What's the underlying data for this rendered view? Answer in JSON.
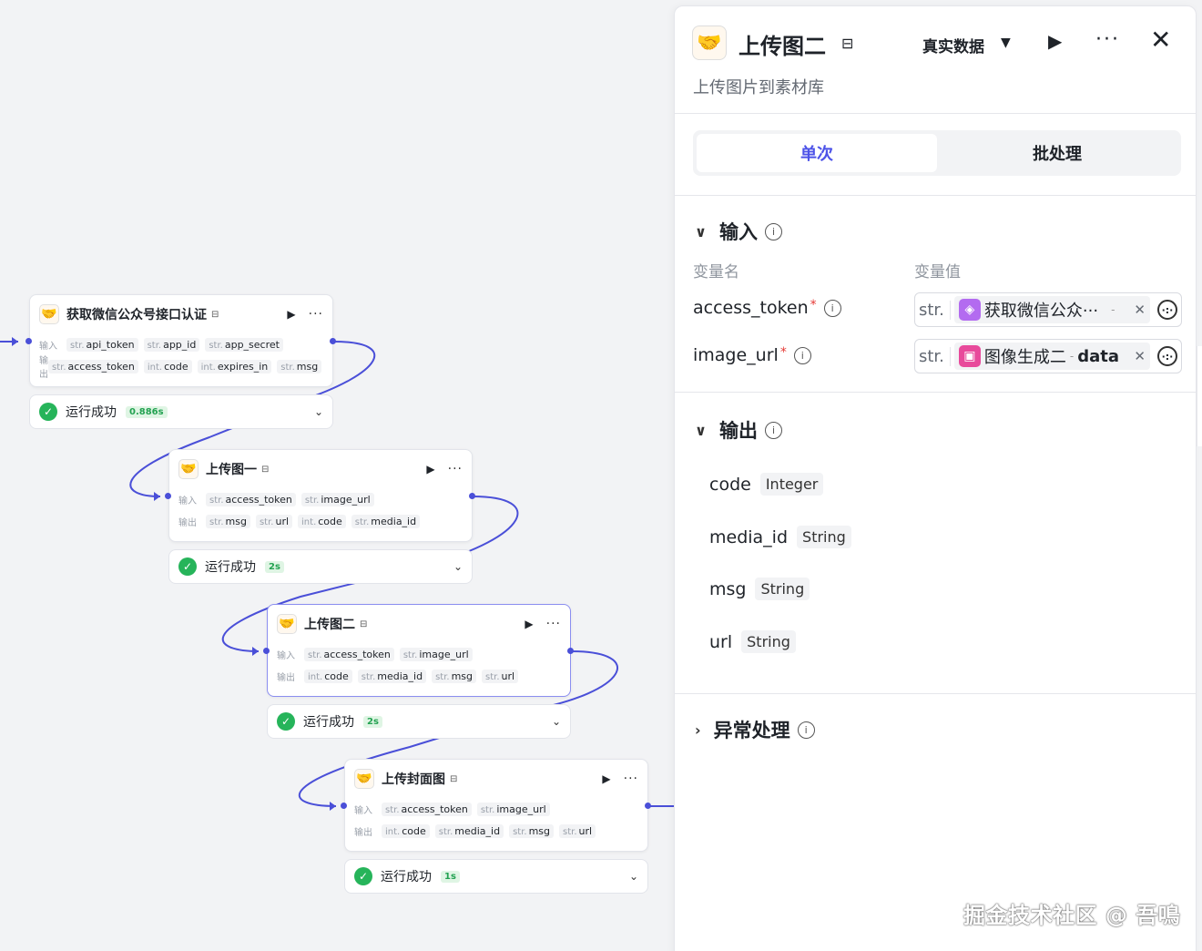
{
  "canvas": {
    "nodes": [
      {
        "title": "获取微信公众号接口认证",
        "badge": "⊟",
        "input_label": "输入",
        "output_label": "输出",
        "inputs": [
          {
            "t": "str.",
            "n": "api_token"
          },
          {
            "t": "str.",
            "n": "app_id"
          },
          {
            "t": "str.",
            "n": "app_secret"
          }
        ],
        "outputs": [
          {
            "t": "str.",
            "n": "access_token"
          },
          {
            "t": "int.",
            "n": "code"
          },
          {
            "t": "int.",
            "n": "expires_in"
          },
          {
            "t": "str.",
            "n": "msg"
          }
        ],
        "status": "运行成功",
        "time": "0.886s"
      },
      {
        "title": "上传图一",
        "badge": "⊟",
        "input_label": "输入",
        "output_label": "输出",
        "inputs": [
          {
            "t": "str.",
            "n": "access_token"
          },
          {
            "t": "str.",
            "n": "image_url"
          }
        ],
        "outputs": [
          {
            "t": "str.",
            "n": "msg"
          },
          {
            "t": "str.",
            "n": "url"
          },
          {
            "t": "int.",
            "n": "code"
          },
          {
            "t": "str.",
            "n": "media_id"
          }
        ],
        "status": "运行成功",
        "time": "2s"
      },
      {
        "title": "上传图二",
        "badge": "⊟",
        "input_label": "输入",
        "output_label": "输出",
        "inputs": [
          {
            "t": "str.",
            "n": "access_token"
          },
          {
            "t": "str.",
            "n": "image_url"
          }
        ],
        "outputs": [
          {
            "t": "int.",
            "n": "code"
          },
          {
            "t": "str.",
            "n": "media_id"
          },
          {
            "t": "str.",
            "n": "msg"
          },
          {
            "t": "str.",
            "n": "url"
          }
        ],
        "status": "运行成功",
        "time": "2s"
      },
      {
        "title": "上传封面图",
        "badge": "⊟",
        "input_label": "输入",
        "output_label": "输出",
        "inputs": [
          {
            "t": "str.",
            "n": "access_token"
          },
          {
            "t": "str.",
            "n": "image_url"
          }
        ],
        "outputs": [
          {
            "t": "int.",
            "n": "code"
          },
          {
            "t": "str.",
            "n": "media_id"
          },
          {
            "t": "str.",
            "n": "msg"
          },
          {
            "t": "str.",
            "n": "url"
          }
        ],
        "status": "运行成功",
        "time": "1s"
      }
    ]
  },
  "panel": {
    "icon": "handshake-icon",
    "title": "上传图二",
    "title_badge": "⊟",
    "data_mode": "真实数据",
    "description": "上传图片到素材库",
    "tabs": [
      "单次",
      "批处理"
    ],
    "input_section": {
      "title": "输入",
      "col_name": "变量名",
      "col_value": "变量值",
      "vars": [
        {
          "name": "access_token",
          "required": "*",
          "type": "str.",
          "ref_text": "获取微信公众···",
          "ref_sep": "-",
          "ref_field": "",
          "ref_color": "#b36bf0"
        },
        {
          "name": "image_url",
          "required": "*",
          "type": "str.",
          "ref_text": "图像生成二",
          "ref_sep": "-",
          "ref_field": "data",
          "ref_color": "#e84a9b"
        }
      ]
    },
    "output_section": {
      "title": "输出",
      "fields": [
        {
          "name": "code",
          "type": "Integer"
        },
        {
          "name": "media_id",
          "type": "String"
        },
        {
          "name": "msg",
          "type": "String"
        },
        {
          "name": "url",
          "type": "String"
        }
      ]
    },
    "error_section": {
      "title": "异常处理"
    }
  },
  "watermark": "掘金技术社区 @ 吾鳴",
  "colors": {
    "accent": "#4d53e8",
    "edge": "#4a4fd8",
    "success": "#26b45a"
  }
}
